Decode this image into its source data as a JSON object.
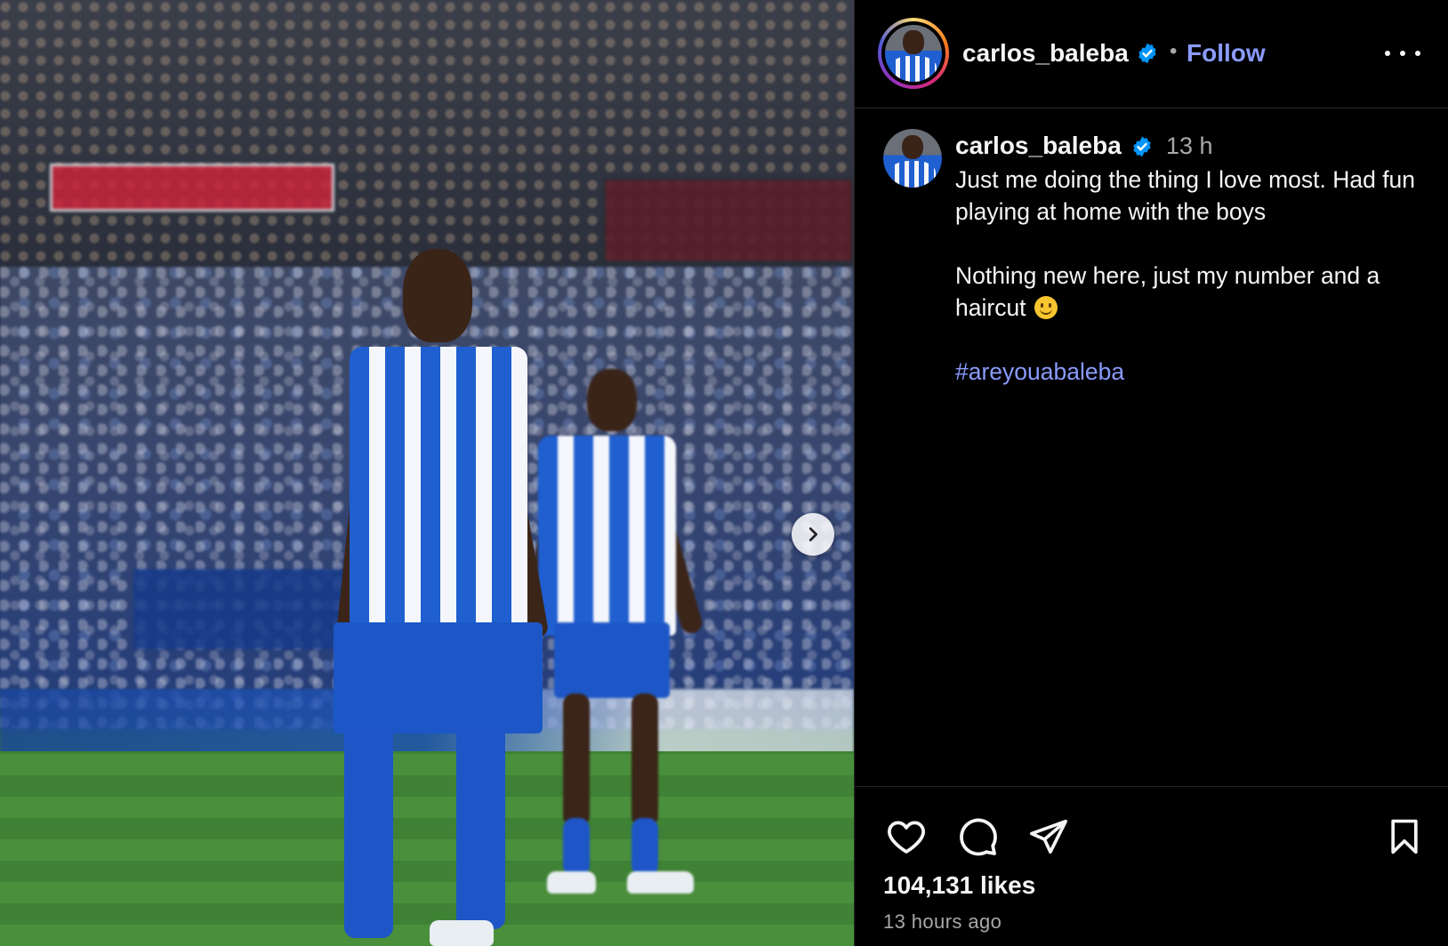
{
  "post": {
    "username": "carlos_baleba",
    "separator": "•",
    "follow_label": "Follow",
    "time_short": "13 h",
    "caption_line1": "Just me doing the thing I love most. Had fun playing at home with the boys",
    "caption_line2": "Nothing new here, just my number and a haircut",
    "hashtag": "#areyouabaleba",
    "likes": "104,131 likes",
    "time_long": "13 hours ago"
  },
  "icons": {
    "verified": "verified-badge-icon",
    "more": "more-options-icon",
    "next": "chevron-right-icon",
    "like": "heart-icon",
    "comment": "comment-bubble-icon",
    "share": "paper-plane-icon",
    "save": "bookmark-icon",
    "emoji": "slightly-smiling-face-emoji"
  },
  "colors": {
    "background": "#000000",
    "text": "#f5f5f5",
    "muted": "#a8a8a8",
    "link": "#8b9bff",
    "verified": "#0095f6",
    "divider": "#262626"
  }
}
